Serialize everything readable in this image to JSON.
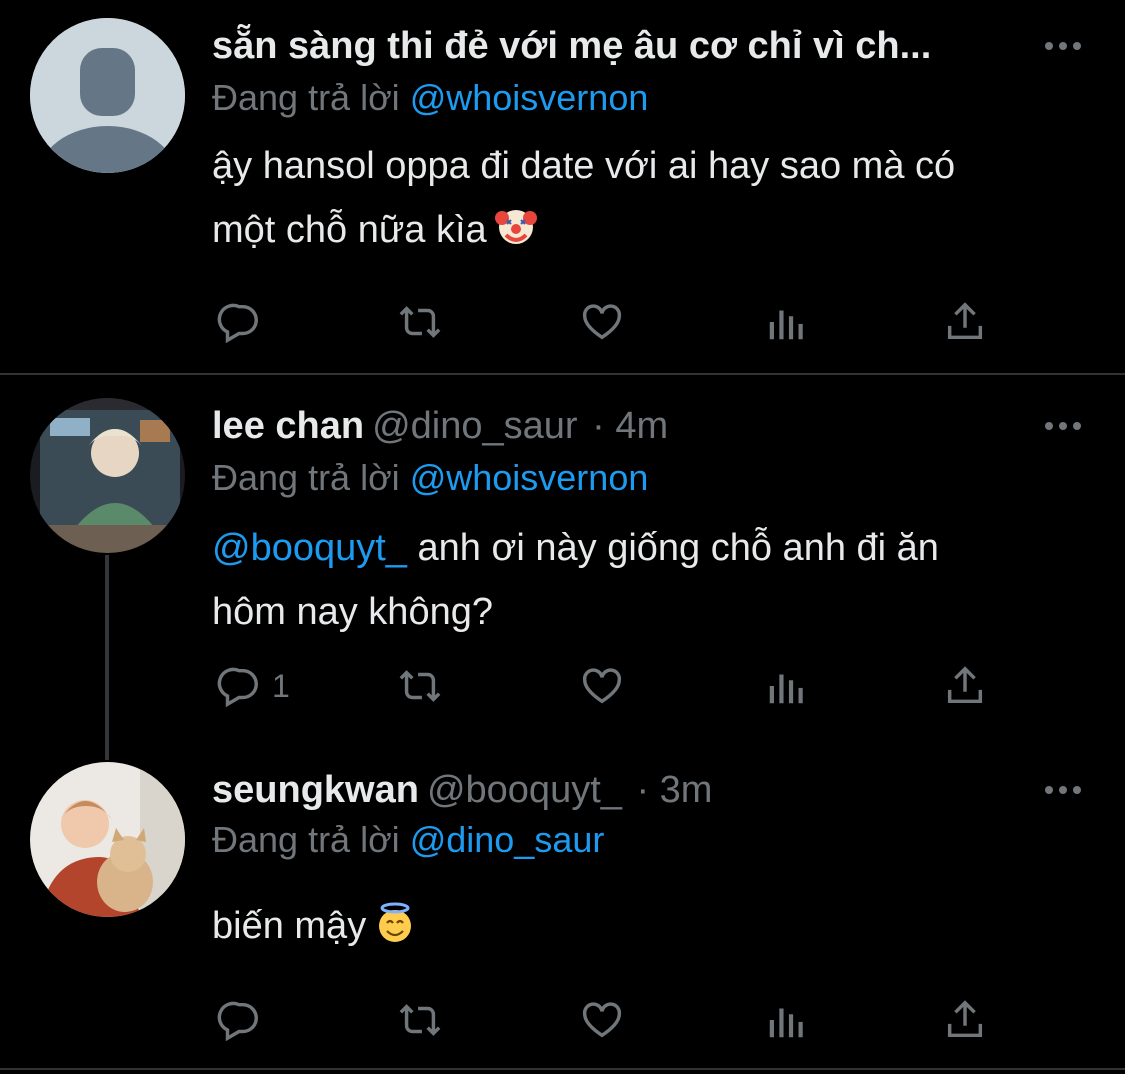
{
  "colors": {
    "background": "#000000",
    "text": "#e7e9ea",
    "secondary": "#71767b",
    "link": "#1d9bf0",
    "divider": "#2f3336"
  },
  "tweets": [
    {
      "name": "sẵn sàng thi đẻ với mẹ âu cơ chỉ vì ch...",
      "handle": "",
      "time": "",
      "reply_prefix": "Đang trả lời",
      "reply_to": "@whoisvernon",
      "body_mention": "",
      "body_line1": "ậy hansol oppa đi date với ai hay sao mà có",
      "body_line2": "một chỗ nữa kìa",
      "emoji": "clown-face",
      "reply_count": "",
      "avatar": "default-avatar"
    },
    {
      "name": "lee chan",
      "handle": "@dino_saur",
      "time": "· 4m",
      "reply_prefix": "Đang trả lời",
      "reply_to": "@whoisvernon",
      "body_mention": "@booquyt_",
      "body_line1": " anh ơi này giống chỗ anh đi ăn",
      "body_line2": "hôm nay không?",
      "reply_count": "1",
      "avatar": "photo-avatar"
    },
    {
      "name": "seungkwan",
      "handle": "@booquyt_",
      "time": "· 3m",
      "reply_prefix": "Đang trả lời",
      "reply_to": "@dino_saur",
      "body_line1": "biến mậy",
      "emoji": "smiling-face-with-halo",
      "reply_count": "",
      "avatar": "photo-avatar"
    }
  ],
  "actions": {
    "icons": [
      "reply-icon",
      "retweet-icon",
      "like-icon",
      "views-icon",
      "share-icon"
    ]
  }
}
